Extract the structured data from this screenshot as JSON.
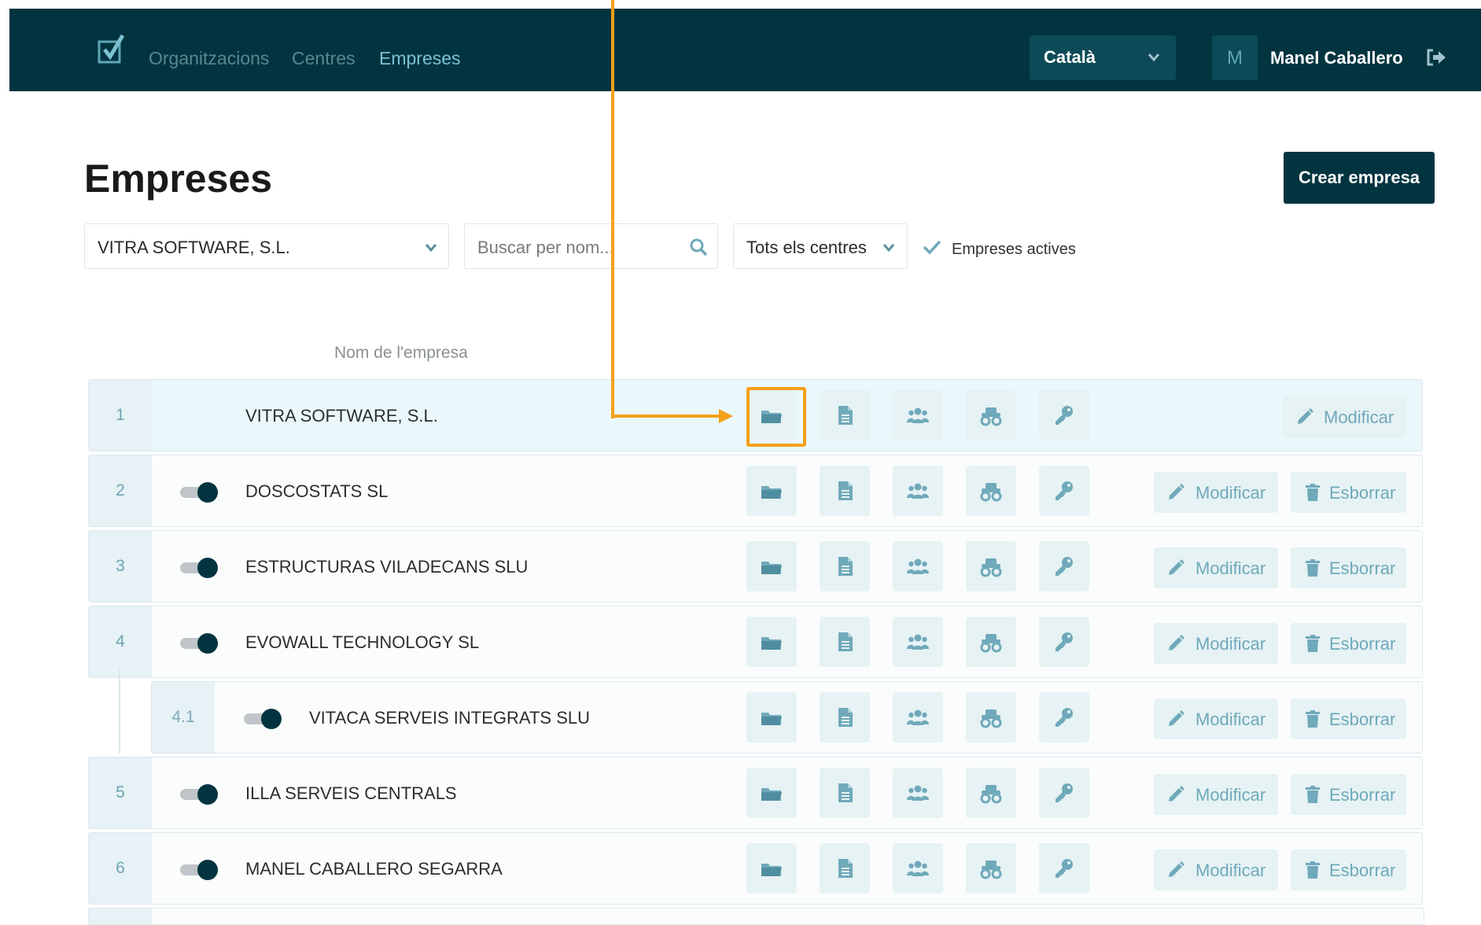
{
  "nav": {
    "links": [
      "Organitzacions",
      "Centres",
      "Empreses"
    ],
    "active": "Empreses",
    "language": "Català",
    "user_initial": "M",
    "user_name": "Manel Caballero"
  },
  "header": {
    "title": "Empreses",
    "create_button": "Crear empresa"
  },
  "filters": {
    "company_selected": "VITRA SOFTWARE, S.L.",
    "search_placeholder": "Buscar per nom...",
    "center_selected": "Tots els centres",
    "active_only_label": "Empreses actives",
    "active_only_checked": true
  },
  "table": {
    "column_name": "Nom de l'empresa",
    "actions": {
      "modify": "Modificar",
      "delete": "Esborrar"
    },
    "rows": [
      {
        "num": "1",
        "name": "VITRA SOFTWARE, S.L.",
        "toggle": null,
        "delete": false
      },
      {
        "num": "2",
        "name": "DOSCOSTATS SL",
        "toggle": true,
        "delete": true
      },
      {
        "num": "3",
        "name": "ESTRUCTURAS VILADECANS SLU",
        "toggle": true,
        "delete": true
      },
      {
        "num": "4",
        "name": "EVOWALL TECHNOLOGY SL",
        "toggle": true,
        "delete": true
      },
      {
        "num": "4.1",
        "name": "VITACA SERVEIS INTEGRATS SLU",
        "toggle": true,
        "delete": true
      },
      {
        "num": "5",
        "name": "ILLA SERVEIS CENTRALS",
        "toggle": true,
        "delete": true
      },
      {
        "num": "6",
        "name": "MANEL CABALLERO SEGARRA",
        "toggle": true,
        "delete": true
      }
    ]
  },
  "colors": {
    "navbar": "#023440",
    "accent": "#6fa9ba",
    "annotation": "#f5a01a"
  }
}
